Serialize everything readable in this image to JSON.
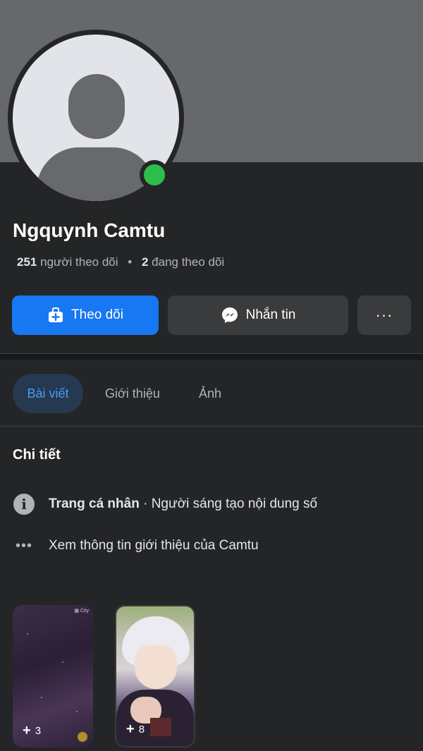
{
  "profile": {
    "name": "Ngquynh Camtu",
    "followers_count": "251",
    "followers_label": "người theo dõi",
    "following_count": "2",
    "following_label": "đang theo dõi",
    "separator": "•",
    "online": true
  },
  "actions": {
    "follow_label": "Theo dõi",
    "message_label": "Nhắn tin",
    "more_label": "···"
  },
  "tabs": [
    {
      "label": "Bài viết",
      "active": true
    },
    {
      "label": "Giới thiệu",
      "active": false
    },
    {
      "label": "Ảnh",
      "active": false
    }
  ],
  "details": {
    "title": "Chi tiết",
    "page_type_bold": "Trang cá nhân",
    "page_type_rest": " · Người sáng tạo nội dung số",
    "see_about": "Xem thông tin giới thiệu của Camtu"
  },
  "highlights": [
    {
      "plus": "+",
      "count": "3"
    },
    {
      "plus": "+",
      "count": "8"
    }
  ],
  "colors": {
    "background": "#242526",
    "cover": "#67686c",
    "primary": "#1877f2",
    "secondary_button": "#3a3b3c",
    "online": "#2fbe4c",
    "tab_active_text": "#4a9cf5"
  },
  "icons": {
    "follow": "person-add-icon",
    "message": "messenger-icon",
    "info": "info-icon",
    "more": "more-dots-icon"
  }
}
